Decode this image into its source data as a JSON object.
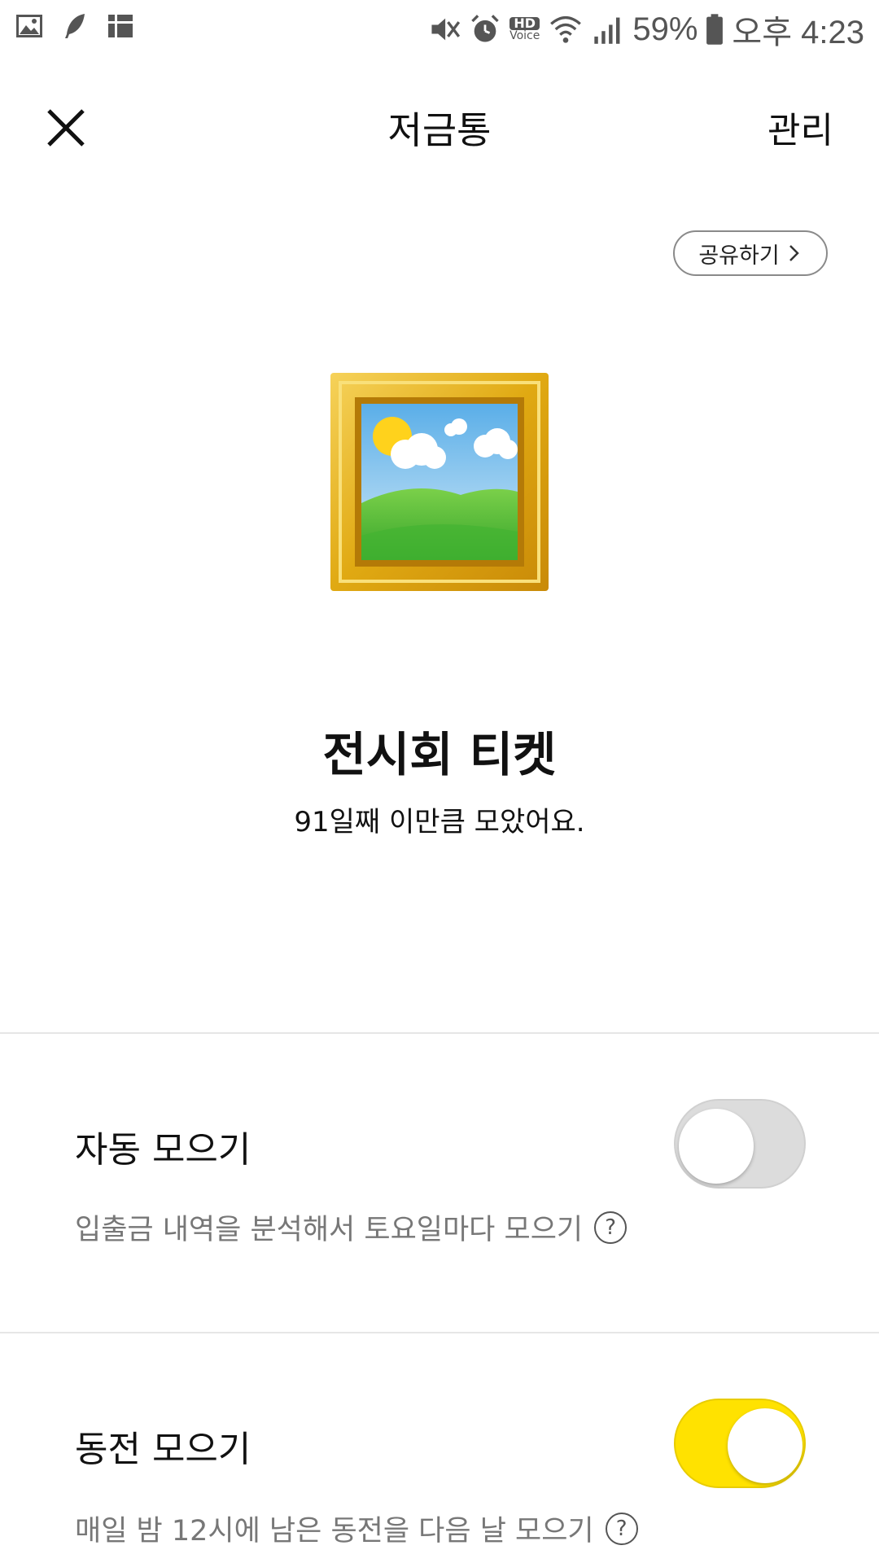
{
  "status_bar": {
    "battery": "59%",
    "time": "오후 4:23",
    "hd_label": "HD",
    "voice_label": "Voice"
  },
  "header": {
    "title": "저금통",
    "manage_label": "관리"
  },
  "share_label": "공유하기",
  "goal": {
    "name": "전시회 티켓",
    "subtitle": "91일째 이만큼 모았어요."
  },
  "settings": [
    {
      "title": "자동 모으기",
      "description": "입출금 내역을 분석해서 토요일마다 모으기",
      "enabled": false
    },
    {
      "title": "동전 모으기",
      "description": "매일 밤 12시에 남은 동전을 다음 날 모으기",
      "enabled": true
    }
  ],
  "help_glyph": "?",
  "colors": {
    "toggle_on": "#ffe200",
    "toggle_off": "#dcdcdc"
  }
}
